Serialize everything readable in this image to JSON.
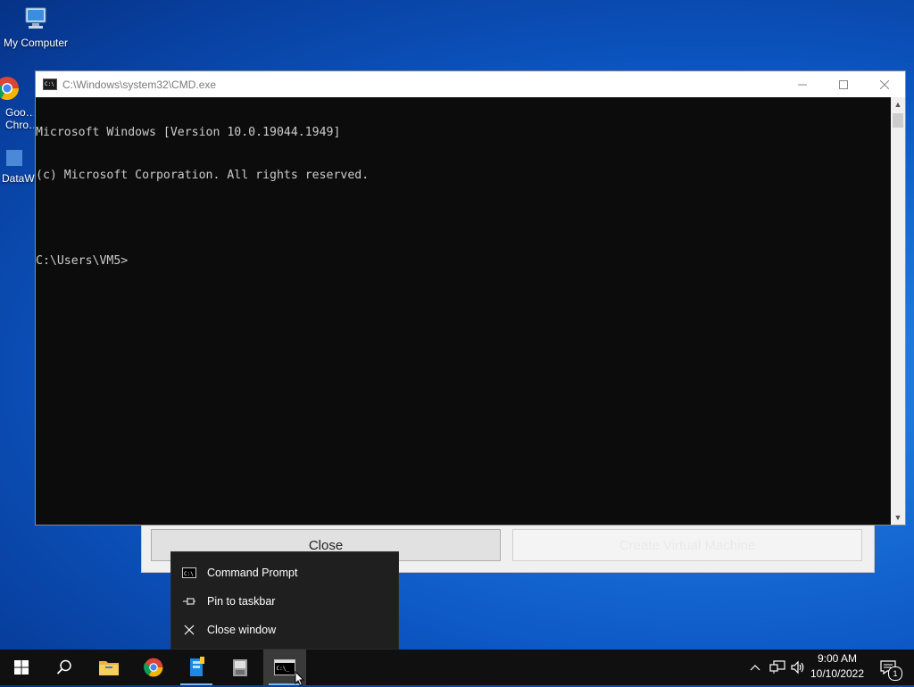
{
  "desktop": {
    "icons": [
      {
        "label": "My Computer"
      },
      {
        "label": "Goo…Chro…"
      },
      {
        "label": "DataW…"
      }
    ]
  },
  "dialog": {
    "close_label": "Close",
    "create_label": "Create Virtual Machine"
  },
  "cmd": {
    "title": "C:\\Windows\\system32\\CMD.exe",
    "lines": [
      "Microsoft Windows [Version 10.0.19044.1949]",
      "(c) Microsoft Corporation. All rights reserved.",
      "",
      "C:\\Users\\VM5>"
    ]
  },
  "jump_list": {
    "items": [
      {
        "label": "Command Prompt",
        "icon": "cmd-icon"
      },
      {
        "label": "Pin to taskbar",
        "icon": "pin-icon"
      },
      {
        "label": "Close window",
        "icon": "close-icon"
      }
    ]
  },
  "taskbar": {
    "time": "9:00 AM",
    "date": "10/10/2022",
    "notification_count": "1"
  },
  "colors": {
    "accent": "#76b9ed",
    "taskbar": "#101010",
    "console_bg": "#0c0c0c"
  }
}
